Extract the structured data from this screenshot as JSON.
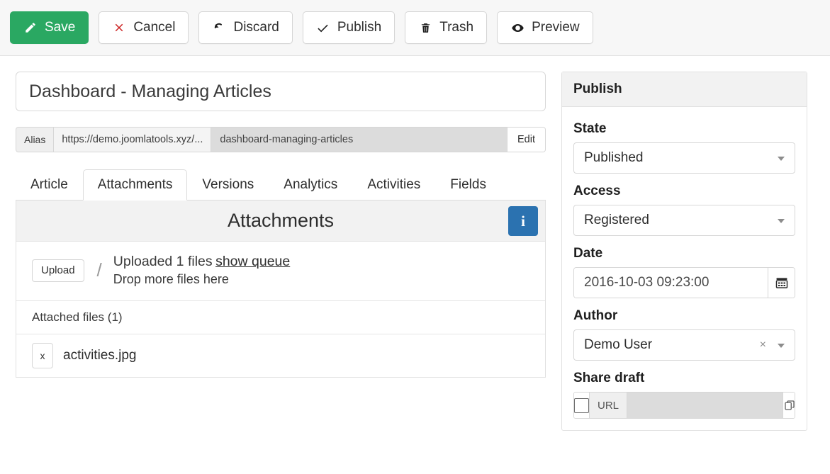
{
  "toolbar": {
    "buttons": [
      {
        "label": "Save",
        "icon": "pencil-icon",
        "primary": true
      },
      {
        "label": "Cancel",
        "icon": "cross-icon",
        "primary": false
      },
      {
        "label": "Discard",
        "icon": "undo-icon",
        "primary": false
      },
      {
        "label": "Publish",
        "icon": "check-icon",
        "primary": false
      },
      {
        "label": "Trash",
        "icon": "trash-icon",
        "primary": false
      },
      {
        "label": "Preview",
        "icon": "eye-icon",
        "primary": false
      }
    ],
    "save_accent_color": "#2aa862",
    "cancel_icon_color": "#cc2121"
  },
  "article": {
    "title_value": "Dashboard - Managing Articles",
    "title_placeholder": "Title",
    "alias": {
      "label": "Alias",
      "url_prefix": "https://demo.joomlatools.xyz/...",
      "slug_value": "dashboard-managing-articles",
      "slug_placeholder": "alias",
      "edit_label": "Edit"
    },
    "tabs": [
      {
        "label": "Article",
        "active": false
      },
      {
        "label": "Attachments",
        "active": true
      },
      {
        "label": "Versions",
        "active": false
      },
      {
        "label": "Analytics",
        "active": false
      },
      {
        "label": "Activities",
        "active": false
      },
      {
        "label": "Fields",
        "active": false
      }
    ]
  },
  "attachments": {
    "panel_title": "Attachments",
    "info_button_icon": "info-icon",
    "info_button_label": "i",
    "info_button_color": "#2b72b0",
    "upload_button_label": "Upload",
    "separator": "/",
    "uploaded_text": "Uploaded 1 files",
    "show_queue_link": "show queue",
    "drop_text": "Drop more files here",
    "list_header": "Attached files (1)",
    "files": [
      {
        "remove_label": "x",
        "name": "activities.jpg"
      }
    ]
  },
  "publish": {
    "panel_title": "Publish",
    "state": {
      "label": "State",
      "value": "Published"
    },
    "access": {
      "label": "Access",
      "value": "Registered"
    },
    "date": {
      "label": "Date",
      "value": "2016-10-03 09:23:00",
      "calendar_icon": "calendar-icon"
    },
    "author": {
      "label": "Author",
      "value": "Demo User",
      "clear_label": "×"
    },
    "share": {
      "label": "Share draft",
      "url_label": "URL",
      "url_value": "",
      "copy_icon": "copy-icon"
    }
  }
}
